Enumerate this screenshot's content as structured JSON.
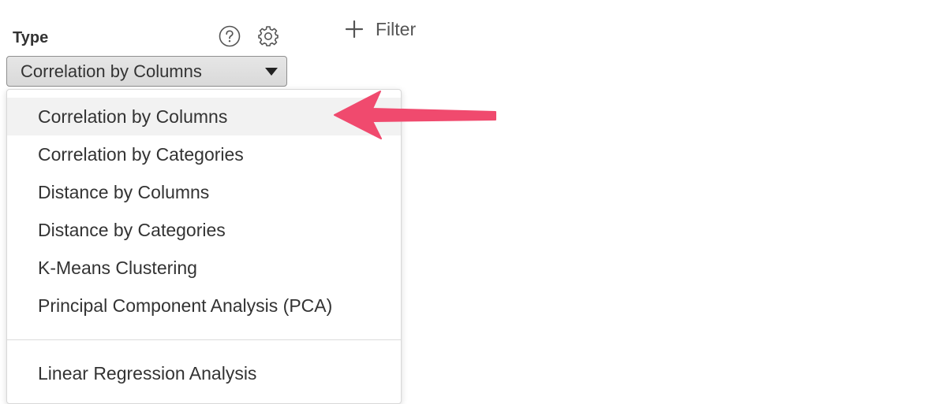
{
  "type_section": {
    "label": "Type",
    "help_icon": "question-circle-icon",
    "settings_icon": "gear-icon"
  },
  "filter": {
    "icon": "plus-icon",
    "label": "Filter"
  },
  "select": {
    "value": "Correlation by Columns",
    "caret_icon": "caret-down-icon"
  },
  "dropdown": {
    "options": [
      {
        "label": "Correlation by Columns",
        "selected": true
      },
      {
        "label": "Correlation by Categories",
        "selected": false
      },
      {
        "label": "Distance by Columns",
        "selected": false
      },
      {
        "label": "Distance by Categories",
        "selected": false
      },
      {
        "label": "K-Means Clustering",
        "selected": false
      },
      {
        "label": "Principal Component Analysis (PCA)",
        "selected": false
      },
      {
        "label": "Linear Regression Analysis",
        "selected": false
      }
    ]
  },
  "annotation": {
    "arrow_color": "#f04a6e"
  }
}
